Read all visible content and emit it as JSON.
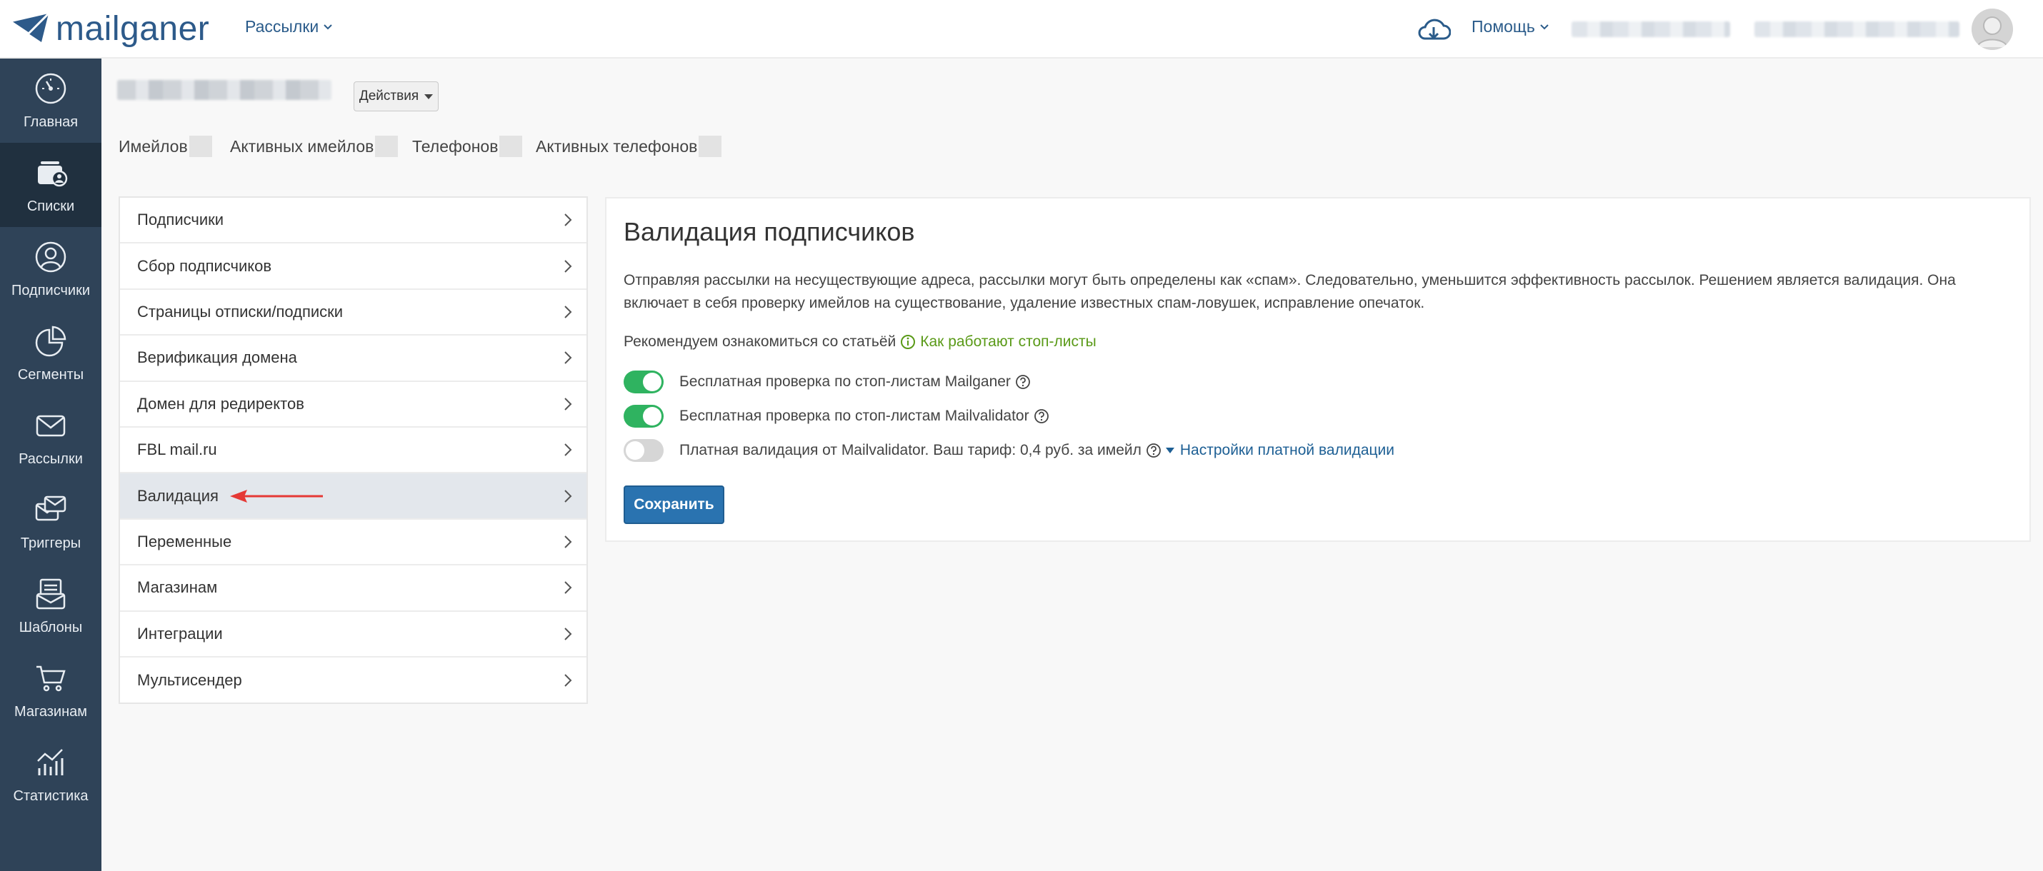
{
  "header": {
    "logo_text": "mailganer",
    "nav_mailings": "Рассылки",
    "nav_help": "Помощь",
    "icons": {
      "logo": "envelope-plane-icon",
      "cloud": "cloud-download-icon",
      "avatar": "user-avatar"
    }
  },
  "sidebar": {
    "items": [
      {
        "label": "Главная",
        "icon": "dashboard-gauge-icon"
      },
      {
        "label": "Списки",
        "icon": "lists-icon",
        "active": true
      },
      {
        "label": "Подписчики",
        "icon": "user-circle-icon"
      },
      {
        "label": "Сегменты",
        "icon": "pie-chart-icon"
      },
      {
        "label": "Рассылки",
        "icon": "envelope-icon"
      },
      {
        "label": "Триггеры",
        "icon": "trigger-envelopes-icon"
      },
      {
        "label": "Шаблоны",
        "icon": "template-icon"
      },
      {
        "label": "Магазинам",
        "icon": "cart-icon"
      },
      {
        "label": "Статистика",
        "icon": "stats-chart-icon"
      }
    ]
  },
  "list_header": {
    "actions_label": "Действия",
    "stats": [
      {
        "label": "Имейлов"
      },
      {
        "label": "Активных имейлов"
      },
      {
        "label": "Телефонов"
      },
      {
        "label": "Активных телефонов"
      }
    ]
  },
  "settings_menu": {
    "items": [
      {
        "label": "Подписчики"
      },
      {
        "label": "Сбор подписчиков"
      },
      {
        "label": "Страницы отписки/подписки"
      },
      {
        "label": "Верификация домена"
      },
      {
        "label": "Домен для редиректов"
      },
      {
        "label": "FBL mail.ru"
      },
      {
        "label": "Валидация",
        "active": true
      },
      {
        "label": "Переменные"
      },
      {
        "label": "Магазинам"
      },
      {
        "label": "Интеграции"
      },
      {
        "label": "Мультисендер"
      }
    ]
  },
  "validation": {
    "title": "Валидация подписчиков",
    "description": "Отправляя рассылки на несуществующие адреса, рассылки могут быть определены как «спам». Следовательно, уменьшится эффективность рассылок. Решением является валидация. Она включает в себя проверку имейлов на существование, удаление известных спам-ловушек, исправление опечаток.",
    "recommend_text": "Рекомендуем ознакомиться со статьёй",
    "recommend_link": "Как работают стоп-листы",
    "options": [
      {
        "label": "Бесплатная проверка по стоп-листам Mailganer",
        "enabled": true
      },
      {
        "label": "Бесплатная проверка по стоп-листам Mailvalidator",
        "enabled": true
      },
      {
        "label": "Платная валидация от Mailvalidator. Ваш тариф: 0,4 руб. за имейл",
        "enabled": false
      }
    ],
    "paid_settings_link": "Настройки платной валидации",
    "save_label": "Сохранить"
  },
  "colors": {
    "sidebar_bg": "#2f4358",
    "sidebar_active": "#20303f",
    "toggle_on": "#2fb360",
    "primary_button": "#2a73b0",
    "link_green": "#5a9a18",
    "link_blue": "#1d5f94",
    "annotation_arrow": "#e53935"
  }
}
